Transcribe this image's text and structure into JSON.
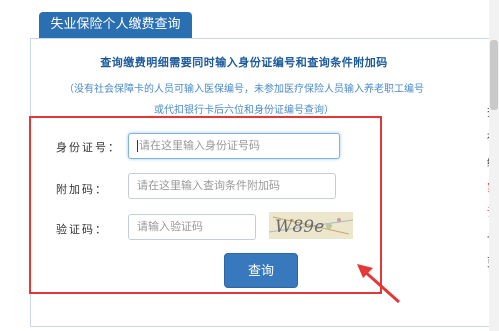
{
  "tab": {
    "title": "失业保险个人缴费查询"
  },
  "notice": {
    "bold": "查询缴费明细需要同时输入身份证编号和查询条件附加码",
    "hint_line1": "（没有社会保障卡的人员可输入医保编号，未参加医疗保险人员输入养老职工编号",
    "hint_line2": "或代扣银行卡后六位和身份证编号查询）"
  },
  "form": {
    "id_label": "身份证号：",
    "id_placeholder": "请在这里输入身份证号码",
    "extra_label": "附加码：",
    "extra_placeholder": "请在这里输入查询条件附加码",
    "captcha_label": "验证码：",
    "captcha_placeholder": "请输入验证码",
    "captcha_text": "W89e",
    "submit_label": "查询"
  },
  "side_panel": {
    "chars": [
      "查",
      "社",
      "缴",
      "实",
      "请",
      "一",
      "更"
    ],
    "colors": [
      "#333333",
      "#333333",
      "#333333",
      "#e23838",
      "#e23838",
      "#333333",
      "#333333"
    ]
  },
  "colors": {
    "accent": "#2b6fb3",
    "highlight": "#e23838",
    "notice_text": "#1c5a9c",
    "hint_text": "#4a8bc9"
  }
}
